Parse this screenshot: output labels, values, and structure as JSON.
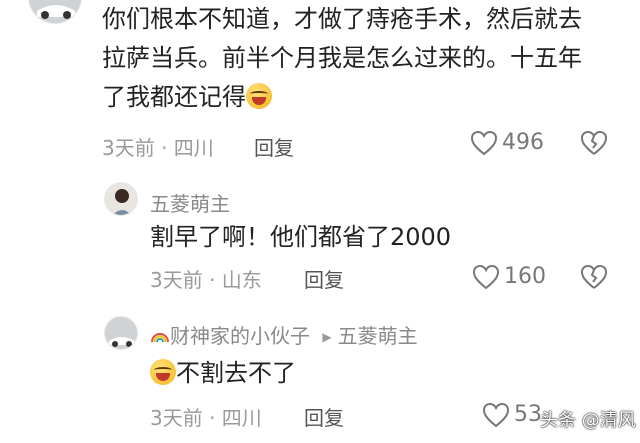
{
  "comments": [
    {
      "text_lines": [
        "你们根本不知道，才做了痔疮手术，然后就去",
        "拉萨当兵。前半个月我是怎么过来的。十五年",
        "了我都还记得"
      ],
      "meta": "3天前 · 四川",
      "reply_label": "回复",
      "like_count": "496"
    },
    {
      "username": "五菱萌主",
      "text": "割早了啊！他们都省了2000",
      "meta": "3天前 · 山东",
      "reply_label": "回复",
      "like_count": "160"
    },
    {
      "username": "财神家的小伙子",
      "reply_to": "五菱萌主",
      "text": "不割去不了",
      "meta": "3天前 · 四川",
      "reply_label": "回复",
      "like_count": "53"
    }
  ],
  "watermark": "头条 @清风"
}
